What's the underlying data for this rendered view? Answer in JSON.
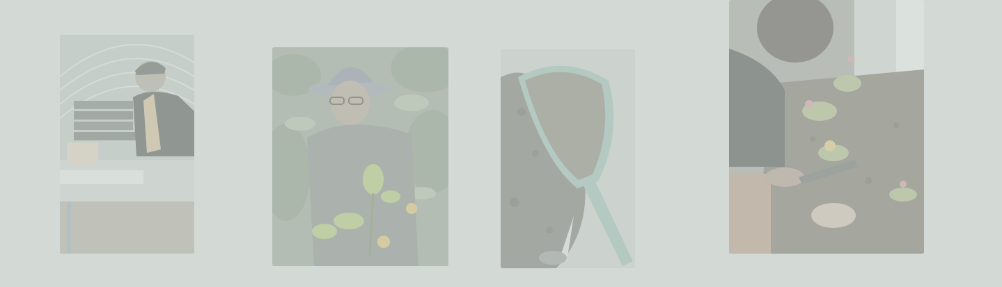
{
  "page": {
    "background_color": "#d3dad6"
  },
  "gallery": {
    "photos": [
      {
        "icon": "greenhouse-worker-photo"
      },
      {
        "icon": "gardener-with-seedling-photo"
      },
      {
        "icon": "soil-scoop-photo"
      },
      {
        "icon": "hands-planting-flowers-photo"
      }
    ]
  }
}
